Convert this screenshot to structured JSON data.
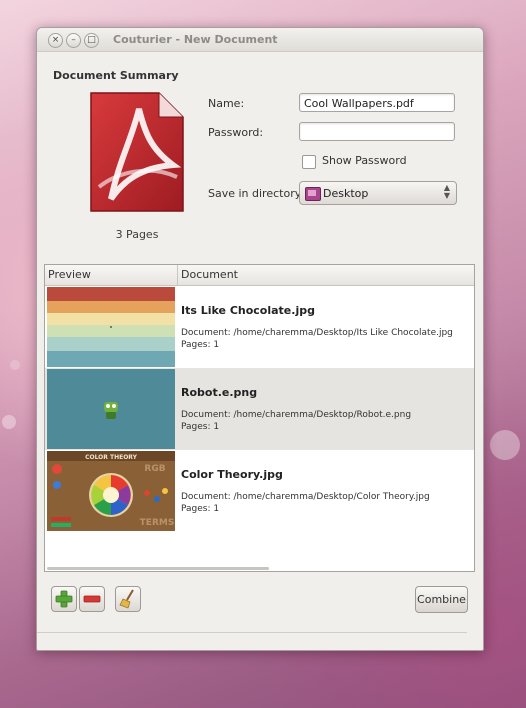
{
  "window": {
    "title": "Couturier - New Document"
  },
  "summary": {
    "heading": "Document Summary",
    "pages_label": "3 Pages",
    "name_label": "Name:",
    "name_value": "Cool Wallpapers.pdf",
    "password_label": "Password:",
    "password_value": "",
    "show_password_label": "Show Password",
    "show_password_checked": false,
    "save_dir_label": "Save in directory:",
    "save_dir_value": "Desktop"
  },
  "list": {
    "columns": [
      "Preview",
      "Document"
    ],
    "rows": [
      {
        "name": "Its Like Chocolate.jpg",
        "path": "Document: /home/charemma/Desktop/Its Like Chocolate.jpg",
        "pages": "Pages: 1"
      },
      {
        "name": "Robot.e.png",
        "path": "Document: /home/charemma/Desktop/Robot.e.png",
        "pages": "Pages: 1"
      },
      {
        "name": "Color Theory.jpg",
        "path": "Document: /home/charemma/Desktop/Color Theory.jpg",
        "pages": "Pages: 1"
      }
    ],
    "thumb3_title": "COLOR THEORY",
    "thumb3_word1": "RGB",
    "thumb3_word2": "TERMS"
  },
  "toolbar": {
    "combine_label": "Combine"
  },
  "icons": {
    "add": "add-icon",
    "remove": "remove-icon",
    "clear": "broom-icon",
    "pdf": "pdf-document-icon",
    "folder": "desktop-folder-icon"
  },
  "colors": {
    "accent": "#a8458e",
    "pdf_red": "#c0282e"
  }
}
